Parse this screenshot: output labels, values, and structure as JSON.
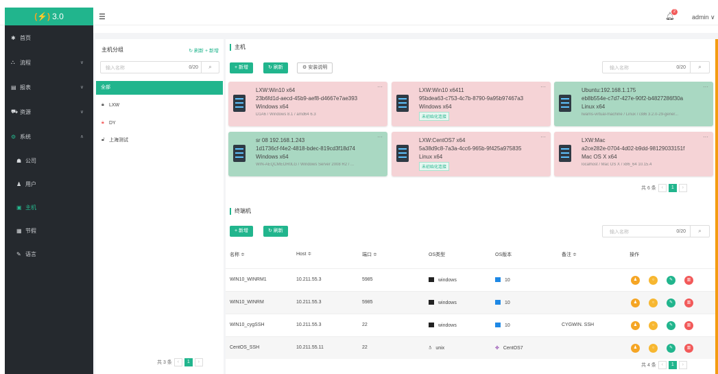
{
  "app": {
    "logo_text": "3.0",
    "logo_mark": "(⚡)",
    "user": "admin ∨",
    "notification_count": "2"
  },
  "sidebar": {
    "items": [
      {
        "icon": "✱",
        "label": "首页",
        "chev": ""
      },
      {
        "icon": "⛬",
        "label": "流程",
        "chev": "∨"
      },
      {
        "icon": "▤",
        "label": "报表",
        "chev": "∨"
      },
      {
        "icon": "⛟",
        "label": "资源",
        "chev": "∨"
      },
      {
        "icon": "⚙",
        "label": "系统",
        "chev": "∧"
      }
    ],
    "subitems": [
      {
        "icon": "☗",
        "label": "公司"
      },
      {
        "icon": "♟",
        "label": "用户"
      },
      {
        "icon": "▣",
        "label": "主机"
      },
      {
        "icon": "▦",
        "label": "节假"
      },
      {
        "icon": "✎",
        "label": "语言"
      }
    ]
  },
  "groups": {
    "title": "主机分组",
    "actions": "↻ 刷新 + 新增",
    "search_placeholder": "输入名称",
    "search_count": "0/20",
    "all_label": "全部",
    "items": [
      {
        "label": "LXW",
        "locked": true
      },
      {
        "label": "DY",
        "locked": true
      },
      {
        "label": "上海测试",
        "locked": false
      }
    ],
    "total": "共 3 条",
    "page": "1"
  },
  "hosts": {
    "title": "主机",
    "add_label": "+ 新增",
    "refresh_label": "↻ 刷新",
    "guide_label": "⚙ 安装说明",
    "search_placeholder": "输入名称",
    "search_count": "0/20",
    "total": "共 6 条",
    "page": "1",
    "cards": [
      {
        "line1": "LXW:Win10 x64",
        "line2": "23b6fd1d-aecd-45b9-aef8-d4667e7ae393",
        "line3": "Windows x64",
        "line4": "D1A6 / Windows 8.1 / amd64 6.3",
        "tag": ""
      },
      {
        "line1": "LXW:Win10 x6411",
        "line2": "95bdea63-c753-4c7b-8790-9a95b97467a3",
        "line3": "Windows x64",
        "line4": "",
        "tag": "未初始化连接"
      },
      {
        "line1": "Ubuntu:192.168.1.175",
        "line2": "eb8b554e-c7d7-427e-90f2-b4827286f30a",
        "line3": "Linux x64",
        "line4": "lwams-virtual-machine / Linux / i386 3.2.0-29-gener...",
        "tag": ""
      },
      {
        "line1": "sr 08 192.168.1.243",
        "line2": "1d1736cf-f4e2-4818-bdec-819cd3f18d74",
        "line3": "Windows x64",
        "line4": "WIN-AEQCMEOR0LG / Windows Server 2008 R2 / ...",
        "tag": ""
      },
      {
        "line1": "LXW:CentOS7 x64",
        "line2": "5a38d9c8-7a3a-4cc6-965b-9f425a975835",
        "line3": "Linux x64",
        "line4": "",
        "tag": "未初始化连接"
      },
      {
        "line1": "LXW:Mac",
        "line2": "a2ce282e-0704-4d02-b9dd-98129033151f",
        "line3": "Mac OS X x64",
        "line4": "localhost / Mac OS X / x86_64 10.15.4",
        "tag": ""
      }
    ]
  },
  "terminals": {
    "title": "终端机",
    "add_label": "+ 新增",
    "refresh_label": "↻ 刷新",
    "search_placeholder": "输入名称",
    "search_count": "0/20",
    "columns": [
      "名称 ≑",
      "Host ≑",
      "端口 ≑",
      "OS类型",
      "OS版本",
      "备注 ≑",
      "操作"
    ],
    "rows": [
      {
        "name": "WIN10_WINRM1",
        "host": "10.211.55.3",
        "port": "5985",
        "os_type": "windows",
        "os_ver": "10",
        "note": ""
      },
      {
        "name": "WIN10_WINRM",
        "host": "10.211.55.3",
        "port": "5985",
        "os_type": "windows",
        "os_ver": "10",
        "note": ""
      },
      {
        "name": "WIN10_cygSSH",
        "host": "10.211.55.3",
        "port": "22",
        "os_type": "windows",
        "os_ver": "10",
        "note": "CYGWIN. SSH"
      },
      {
        "name": "CentOS_SSH",
        "host": "10.211.55.11",
        "port": "22",
        "os_type": "unix",
        "os_ver": "CentOS7",
        "note": ""
      }
    ],
    "total": "共 4 条",
    "page": "1"
  }
}
